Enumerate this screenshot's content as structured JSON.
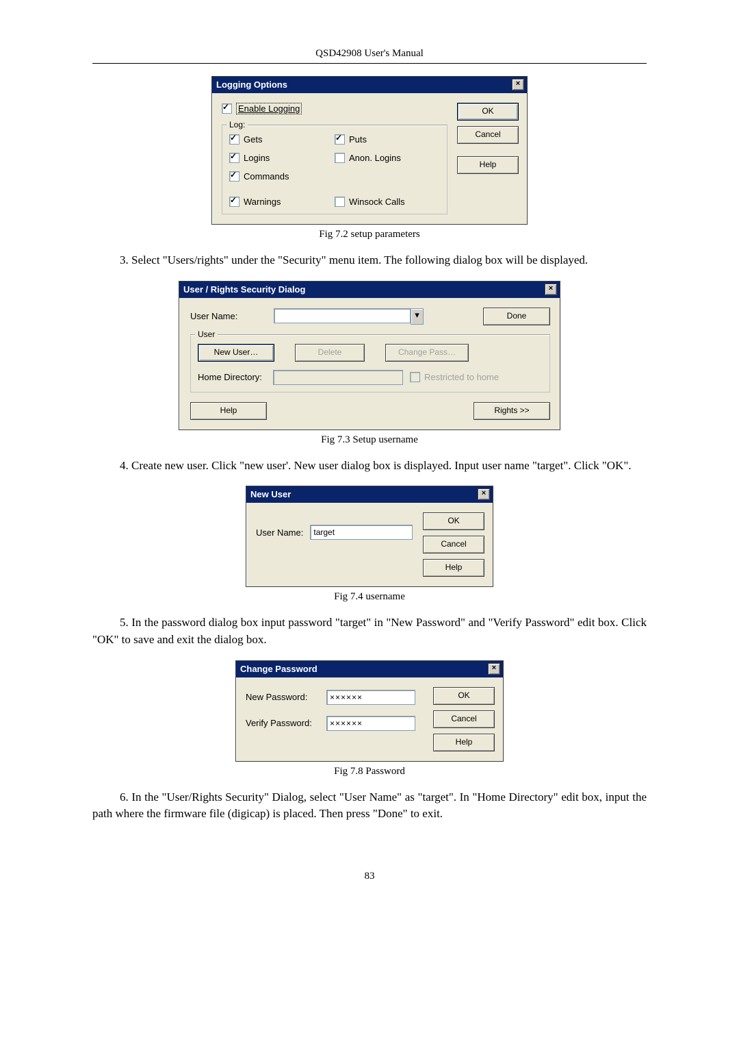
{
  "header": "QSD42908 User's Manual",
  "page_number": "83",
  "dialog1": {
    "title": "Logging Options",
    "enable_logging": "Enable Logging",
    "group_log": "Log:",
    "gets": "Gets",
    "puts": "Puts",
    "logins": "Logins",
    "anon_logins": "Anon. Logins",
    "commands": "Commands",
    "warnings": "Warnings",
    "winsock": "Winsock Calls",
    "ok": "OK",
    "cancel": "Cancel",
    "help": "Help"
  },
  "caption1": "Fig 7.2 setup parameters",
  "step3": "3.    Select \"Users/rights\" under the \"Security\" menu item. The following dialog box will be displayed.",
  "dialog2": {
    "title": "User / Rights Security Dialog",
    "user_name_label": "User Name:",
    "group_user": "User",
    "new_user": "New User…",
    "delete": "Delete",
    "change_pass": "Change Pass…",
    "home_dir": "Home Directory:",
    "restricted": "Restricted to home",
    "done": "Done",
    "help": "Help",
    "rights": "Rights >>"
  },
  "caption2": "Fig 7.3 Setup username",
  "step4": "4.    Create new user. Click \"new user'. New user dialog box is displayed. Input user name \"target\". Click \"OK\".",
  "dialog3": {
    "title": "New User",
    "user_name_label": "User Name:",
    "value": "target",
    "ok": "OK",
    "cancel": "Cancel",
    "help": "Help"
  },
  "caption3": "Fig 7.4 username",
  "step5": "5.    In the password dialog box input password \"target\" in \"New Password\" and \"Verify Password\" edit box. Click \"OK\" to save and exit the dialog box.",
  "dialog4": {
    "title": "Change Password",
    "new_pw": "New Password:",
    "verify_pw": "Verify Password:",
    "value": "××××××",
    "ok": "OK",
    "cancel": "Cancel",
    "help": "Help"
  },
  "caption4": "Fig 7.8 Password",
  "step6": "6.    In the \"User/Rights Security\" Dialog, select \"User Name\" as \"target\". In \"Home Directory\" edit box, input the path where the firmware file (digicap) is placed. Then press \"Done\" to exit."
}
